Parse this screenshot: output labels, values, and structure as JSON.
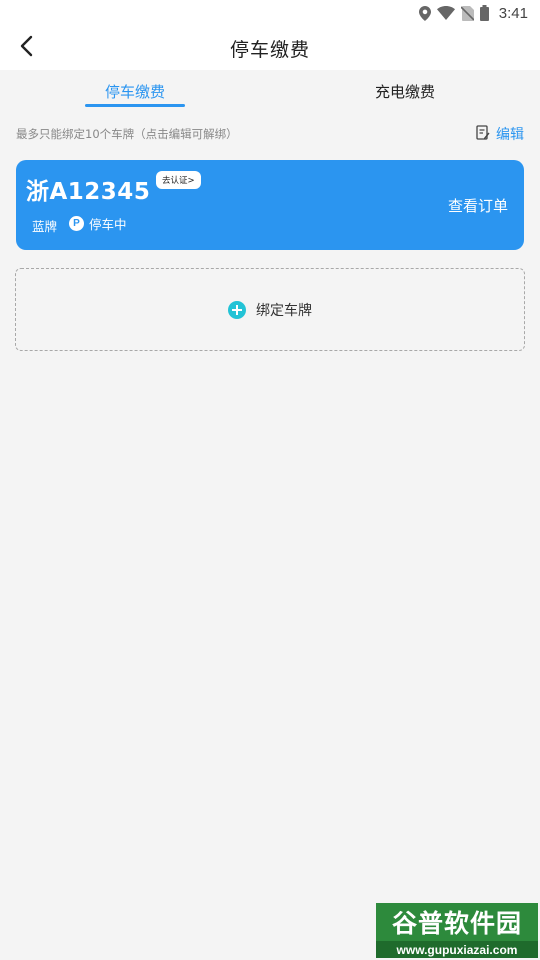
{
  "status_bar": {
    "time": "3:41",
    "icons": [
      "location-icon",
      "wifi-icon",
      "no-sim-icon",
      "battery-icon"
    ]
  },
  "header": {
    "title": "停车缴费",
    "back_icon": "chevron-left-icon"
  },
  "tabs": [
    {
      "label": "停车缴费",
      "active": true
    },
    {
      "label": "充电缴费",
      "active": false
    }
  ],
  "hint": {
    "text": "最多只能绑定10个车牌（点击编辑可解绑）",
    "edit_label": "编辑"
  },
  "plates": [
    {
      "number": "浙A12345",
      "verify_badge": "去认证>",
      "type": "蓝牌",
      "status": "停车中",
      "status_icon_letter": "P",
      "action": "查看订单"
    }
  ],
  "bind_plate": {
    "label": "绑定车牌"
  },
  "watermark": {
    "title": "谷普软件园",
    "url": "www.gupuxiazai.com"
  },
  "colors": {
    "accent": "#2b95f0",
    "plus": "#22c3d6",
    "background": "#f4f4f4"
  }
}
